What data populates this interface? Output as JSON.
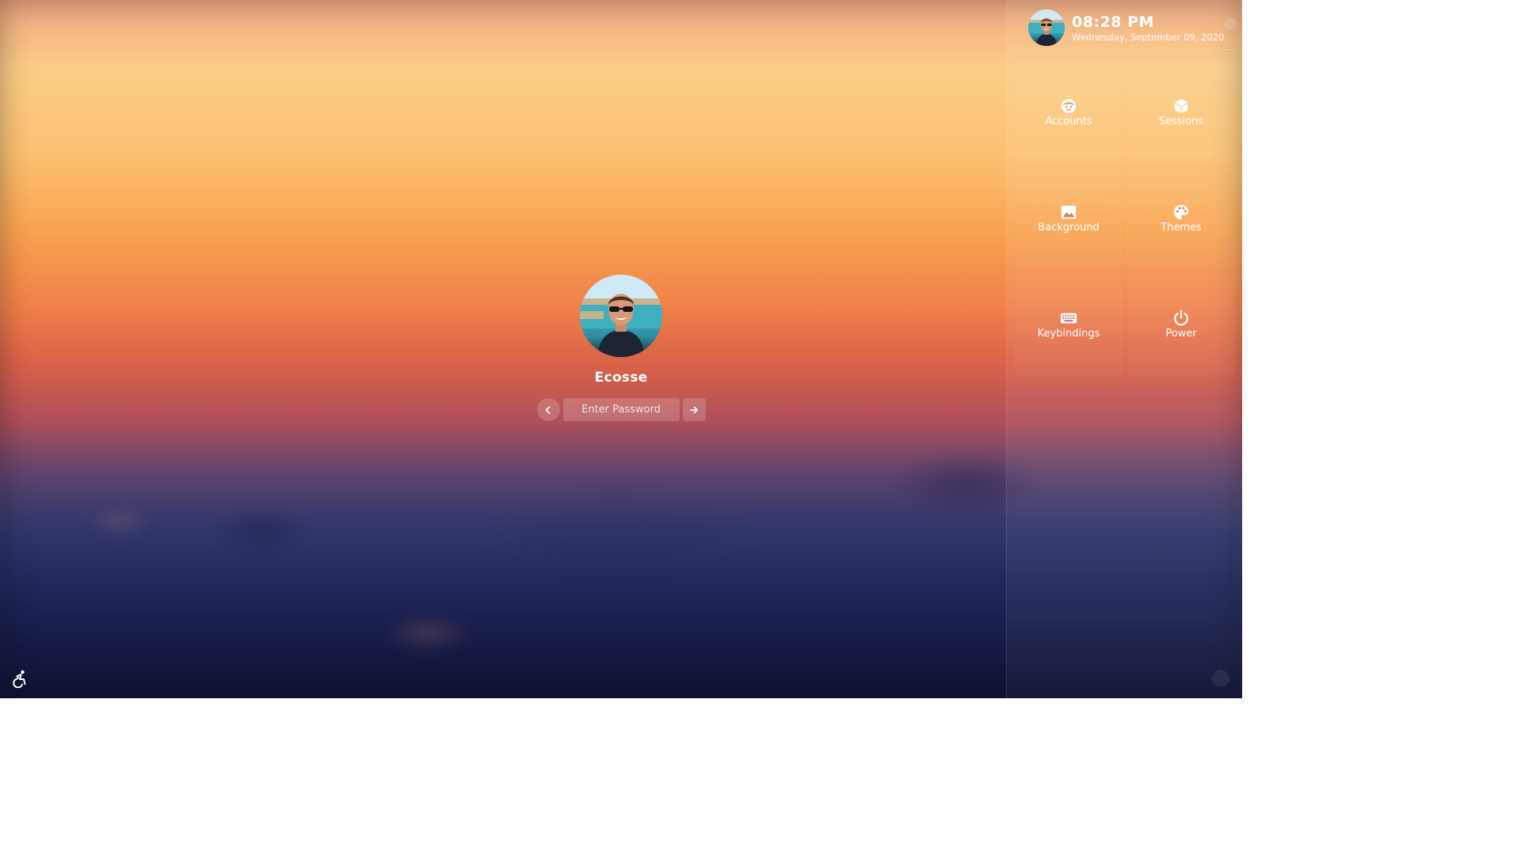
{
  "login": {
    "username": "Ecosse",
    "password_placeholder": "Enter Password"
  },
  "panel": {
    "time": "08:28 PM",
    "date": "Wednesday, September 09, 2020",
    "tiles": [
      {
        "label": "Accounts",
        "icon": "user-face-icon"
      },
      {
        "label": "Sessions",
        "icon": "cube-icon"
      },
      {
        "label": "Background",
        "icon": "image-icon"
      },
      {
        "label": "Themes",
        "icon": "palette-icon"
      },
      {
        "label": "Keybindings",
        "icon": "keyboard-icon"
      },
      {
        "label": "Power",
        "icon": "power-icon"
      }
    ]
  },
  "icons": {
    "back": "chevron-left-icon",
    "submit": "arrow-right-icon",
    "accessibility": "accessibility-icon"
  },
  "colors": {
    "text": "#ffffff",
    "sky_top": "#fbcd86",
    "sky_mid": "#f0804a",
    "city_bottom": "#151a45"
  }
}
